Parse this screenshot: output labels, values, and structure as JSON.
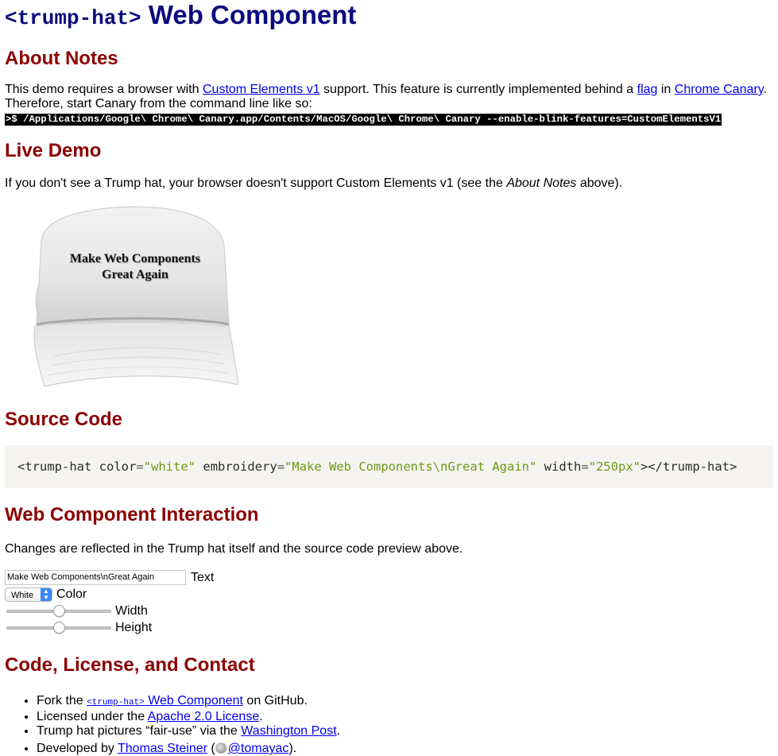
{
  "header": {
    "title_code": "<trump-hat>",
    "title_text": "Web Component"
  },
  "about": {
    "heading": "About Notes",
    "text1": "This demo requires a browser with ",
    "link_custom_elements": "Custom Elements v1",
    "text2": " support. This feature is currently implemented behind a ",
    "link_flag": "flag",
    "text3": " in ",
    "link_canary": "Chrome Canary",
    "text4": ".",
    "text5": "Therefore, start Canary from the command line like so:",
    "command": ">$ /Applications/Google\\ Chrome\\ Canary.app/Contents/MacOS/Google\\ Chrome\\ Canary --enable-blink-features=CustomElementsV1"
  },
  "live_demo": {
    "heading": "Live Demo",
    "text1": "If you don't see a Trump hat, your browser doesn't support Custom Elements v1 (see the ",
    "emphasis": "About Notes",
    "text2": " above).",
    "hat_line1": "Make Web Components",
    "hat_line2": "Great Again"
  },
  "source_code": {
    "heading": "Source Code",
    "tag_open": "<trump-hat",
    "attr_color": "color",
    "val_color": "\"white\"",
    "attr_embroidery": "embroidery",
    "val_embroidery": "\"Make Web Components\\nGreat Again\"",
    "attr_width": "width",
    "val_width": "\"250px\"",
    "tag_close": "></trump-hat>"
  },
  "interaction": {
    "heading": "Web Component Interaction",
    "text": "Changes are reflected in the Trump hat itself and the source code preview above.",
    "text_input_value": "Make Web Components\\nGreat Again",
    "text_label": "Text",
    "color_value": "White",
    "color_label": "Color",
    "width_label": "Width",
    "width_level": 0.5,
    "height_label": "Height",
    "height_level": 0.5
  },
  "contact": {
    "heading": "Code, License, and Contact",
    "item1_pre": "Fork the ",
    "item1_link_code": "<trump-hat>",
    "item1_link_text": " Web Component",
    "item1_post": " on GitHub.",
    "item2_pre": "Licensed under the ",
    "item2_link": "Apache 2.0 License",
    "item2_post": ".",
    "item3_pre": "Trump hat pictures “fair-use” via the ",
    "item3_link": "Washington Post",
    "item3_post": ".",
    "item4_pre": "Developed by ",
    "item4_link": "Thomas Steiner",
    "item4_mid": " (",
    "item4_handle": "@tomayac",
    "item4_post": ")."
  },
  "colors": {
    "title": "#0b0b80",
    "heading": "#8b0000",
    "link": "#0000ee",
    "code_value": "#6a9a16",
    "code_bg": "#f6f4f0"
  }
}
